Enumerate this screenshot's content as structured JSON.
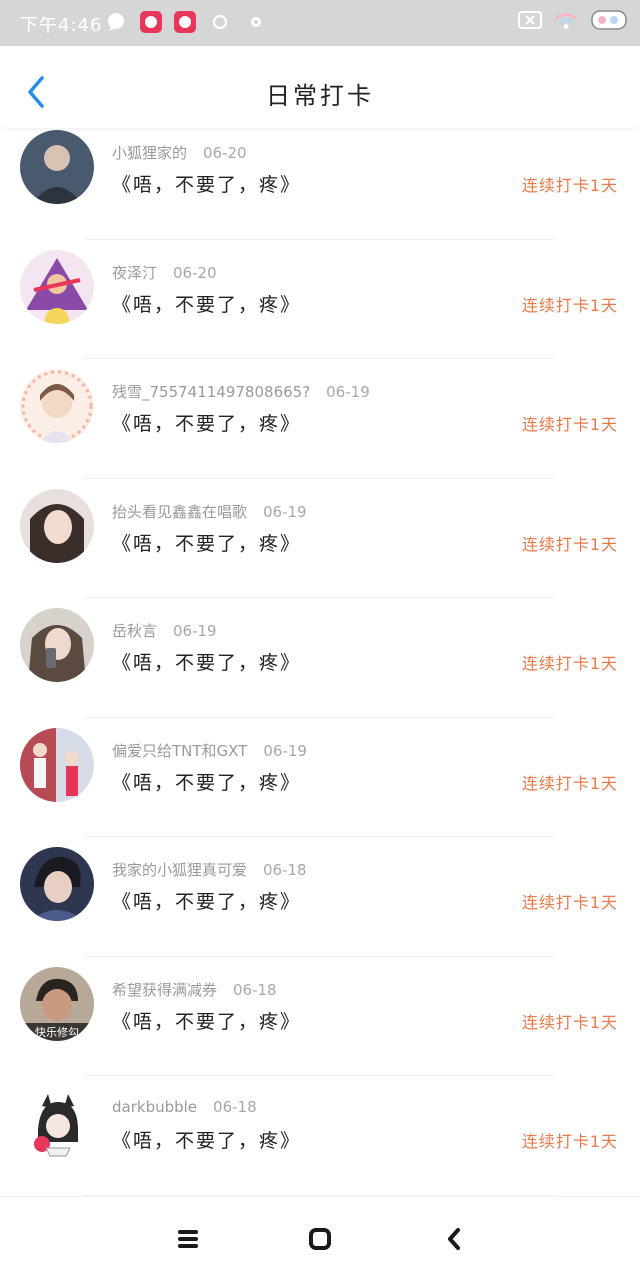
{
  "status": {
    "time": "下午4:46"
  },
  "header": {
    "title": "日常打卡"
  },
  "entries": [
    {
      "username": "小狐狸家的",
      "date": "06-20",
      "quote": "《唔，不要了，疼》",
      "streak": "连续打卡1天",
      "avatar": "#4a5a6e"
    },
    {
      "username": "夜泽汀",
      "date": "06-20",
      "quote": "《唔，不要了，疼》",
      "streak": "连续打卡1天",
      "avatar": "#8a4aa8"
    },
    {
      "username": "残雪_7557411497808665?",
      "date": "06-19",
      "quote": "《唔，不要了，疼》",
      "streak": "连续打卡1天",
      "avatar": "#f0d6c8"
    },
    {
      "username": "抬头看见鑫鑫在唱歌",
      "date": "06-19",
      "quote": "《唔，不要了，疼》",
      "streak": "连续打卡1天",
      "avatar": "#3a2e2a"
    },
    {
      "username": "岳秋言",
      "date": "06-19",
      "quote": "《唔，不要了，疼》",
      "streak": "连续打卡1天",
      "avatar": "#5a4a40"
    },
    {
      "username": "偏爱只给TNT和GXT",
      "date": "06-19",
      "quote": "《唔，不要了，疼》",
      "streak": "连续打卡1天",
      "avatar": "#b84a56"
    },
    {
      "username": "我家的小狐狸真可爱",
      "date": "06-18",
      "quote": "《唔，不要了，疼》",
      "streak": "连续打卡1天",
      "avatar": "#2e3650"
    },
    {
      "username": "希望获得满减券",
      "date": "06-18",
      "quote": "《唔，不要了，疼》",
      "streak": "连续打卡1天",
      "avatar": "#6a5a4a",
      "avatar_caption": "快乐修勾"
    },
    {
      "username": "darkbubble",
      "date": "06-18",
      "quote": "《唔，不要了，疼》",
      "streak": "连续打卡1天",
      "avatar": "#f5f5f5"
    }
  ]
}
